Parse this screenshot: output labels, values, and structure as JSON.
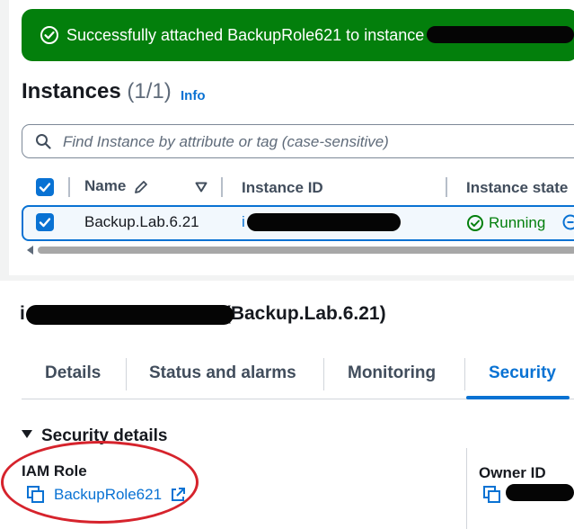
{
  "flash": {
    "message": "Successfully attached BackupRole621 to instance i-",
    "status_color": "#037f0c"
  },
  "instances": {
    "title": "Instances",
    "count": "(1/1)",
    "info_link": "Info",
    "search_placeholder": "Find Instance by attribute or tag (case-sensitive)",
    "columns": [
      "Name",
      "Instance ID",
      "Instance state"
    ],
    "rows": [
      {
        "name": "Backup.Lab.6.21",
        "instance_id": "i",
        "state": "Running",
        "selected": true
      }
    ]
  },
  "detail": {
    "title_prefix": "i",
    "title_suffix": "(Backup.Lab.6.21)",
    "tabs": [
      "Details",
      "Status and alarms",
      "Monitoring",
      "Security"
    ],
    "active_tab": "Security",
    "section_title": "Security details",
    "iam_role_label": "IAM Role",
    "iam_role_value": "BackupRole621",
    "owner_id_label": "Owner ID"
  },
  "colors": {
    "accent": "#0972d3",
    "success": "#037f0c",
    "annotation": "#d6232c"
  },
  "icons": [
    "check-circle-icon",
    "search-icon",
    "checkbox-checked-icon",
    "pencil-icon",
    "sort-down-icon",
    "running-status-icon",
    "copy-icon",
    "external-link-icon",
    "caret-down-icon"
  ]
}
